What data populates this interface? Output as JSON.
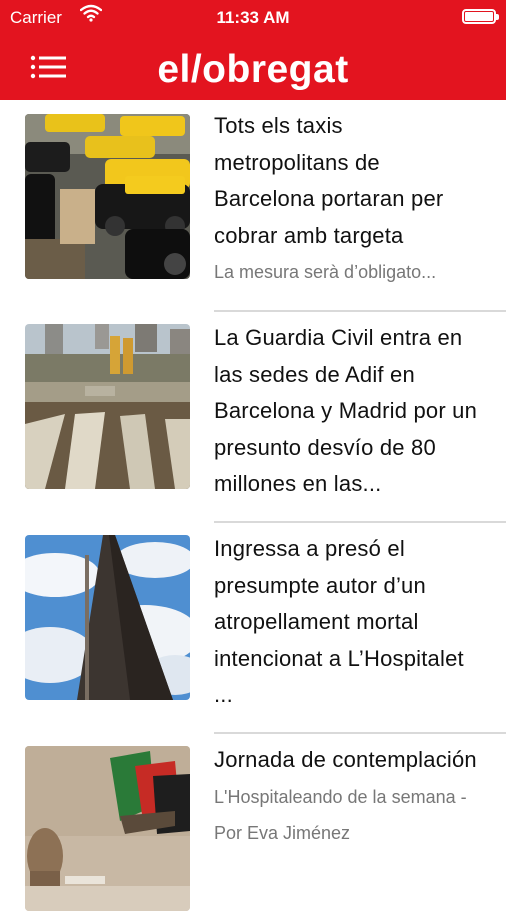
{
  "status_bar": {
    "carrier": "Carrier",
    "time": "11:33 AM",
    "battery_level": 1.0
  },
  "header": {
    "logo_text": "el/obregat",
    "menu_icon": "hamburger-menu-icon",
    "background_color": "#e3141f"
  },
  "articles": [
    {
      "title": "Tots els taxis metropolitans de Barcelona portaran per cobrar amb targeta",
      "summary": "La mesura serà d’obligato...",
      "image": "taxis-photo"
    },
    {
      "title": "La Guardia Civil entra en las sedes de Adif en Barcelona y Madrid por un presunto desvío de 80 millones en las...",
      "summary": "",
      "image": "construction-site-photo"
    },
    {
      "title": "Ingressa a presó el presumpte autor d’un atropellament mortal intencionat a L’Hospitalet ...",
      "summary": "",
      "image": "monument-photo"
    },
    {
      "title": "Jornada de contemplación",
      "summary": "L'Hospitaleando de la semana - Por Eva Jiménez",
      "image": "sculpture-photo"
    }
  ]
}
